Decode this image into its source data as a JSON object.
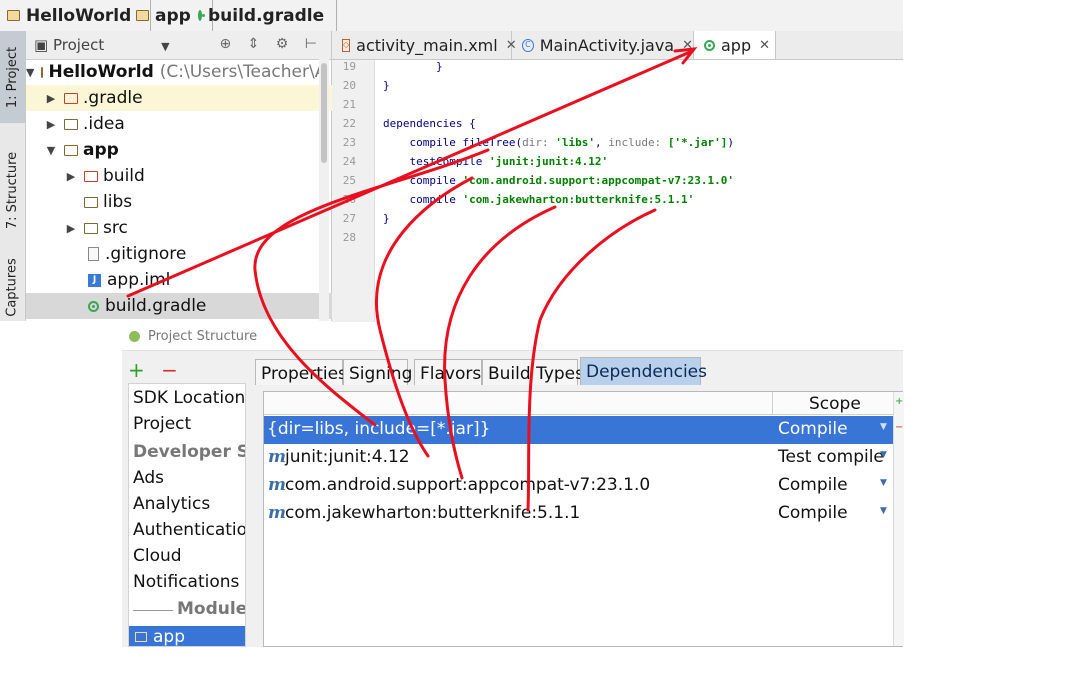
{
  "breadcrumb": {
    "items": [
      {
        "label": "HelloWorld",
        "icon": "folder-icon"
      },
      {
        "label": "app",
        "icon": "folder-icon"
      },
      {
        "label": "build.gradle",
        "icon": "gradle-icon"
      }
    ]
  },
  "tool_strip": {
    "tabs": [
      "1: Project",
      "7: Structure",
      "Captures"
    ]
  },
  "project_panel": {
    "title": "Project",
    "header_tools": "⊕ ⇕ ⚙ ⊢",
    "tree": [
      {
        "label": "HelloWorld",
        "suffix": "(C:\\Users\\Teacher\\A",
        "bold": true,
        "expanded": true
      },
      {
        "label": ".gradle",
        "expanded": false
      },
      {
        "label": ".idea",
        "expanded": false
      },
      {
        "label": "app",
        "bold": true,
        "expanded": true
      },
      {
        "label": "build",
        "expanded": false
      },
      {
        "label": "libs"
      },
      {
        "label": "src",
        "expanded": false
      },
      {
        "label": ".gitignore"
      },
      {
        "label": "app.iml"
      },
      {
        "label": "build.gradle",
        "selected": true
      }
    ]
  },
  "editor": {
    "tabs": [
      {
        "label": "activity_main.xml",
        "icon": "xml-file-icon"
      },
      {
        "label": "MainActivity.java",
        "icon": "java-class-icon"
      },
      {
        "label": "app",
        "icon": "gradle-icon",
        "active": true
      }
    ],
    "lines": [
      {
        "num": "19",
        "text": "        }"
      },
      {
        "num": "20",
        "text": "}"
      },
      {
        "num": "21",
        "text": ""
      },
      {
        "num": "22",
        "text": "dependencies {"
      },
      {
        "num": "23",
        "pre": "    compile fileTree(",
        "lbl1": "dir: ",
        "s1": "'libs'",
        "mid": ", ",
        "lbl2": "include: ",
        "s2": "['*.jar']",
        "post": ")"
      },
      {
        "num": "24",
        "pre": "    testCompile ",
        "s1": "'junit:junit:4.12'"
      },
      {
        "num": "25",
        "pre": "    compile ",
        "s1": "'com.android.support:appcompat-v7:23.1.0'"
      },
      {
        "num": "26",
        "pre": "    compile ",
        "s1": "'com.jakewharton:butterknife:5.1.1'"
      },
      {
        "num": "27",
        "text": "}"
      },
      {
        "num": "28",
        "text": ""
      }
    ]
  },
  "dialog": {
    "title": "Project Structure",
    "add_label": "+",
    "remove_label": "−",
    "side_items": [
      "SDK Location",
      "Project"
    ],
    "developer_services_header": "Developer Services",
    "service_items": [
      "Ads",
      "Analytics",
      "Authentication",
      "Cloud",
      "Notifications"
    ],
    "modules_header": "Modules",
    "selected_module": "app",
    "tabs": [
      "Properties",
      "Signing",
      "Flavors",
      "Build Types",
      "Dependencies"
    ],
    "active_tab": "Dependencies",
    "table": {
      "scope_header": "Scope",
      "rows": [
        {
          "name": "{dir=libs, include=[*.jar]}",
          "scope": "Compile",
          "maven": false,
          "selected": true
        },
        {
          "name": "junit:junit:4.12",
          "scope": "Test compile",
          "maven": true
        },
        {
          "name": "com.android.support:appcompat-v7:23.1.0",
          "scope": "Compile",
          "maven": true
        },
        {
          "name": "com.jakewharton:butterknife:5.1.1",
          "scope": "Compile",
          "maven": true
        }
      ],
      "maven_marker": "m"
    }
  },
  "colors": {
    "selection": "#3875d7",
    "annotation": "#e8101e",
    "string_green": "#008000"
  }
}
